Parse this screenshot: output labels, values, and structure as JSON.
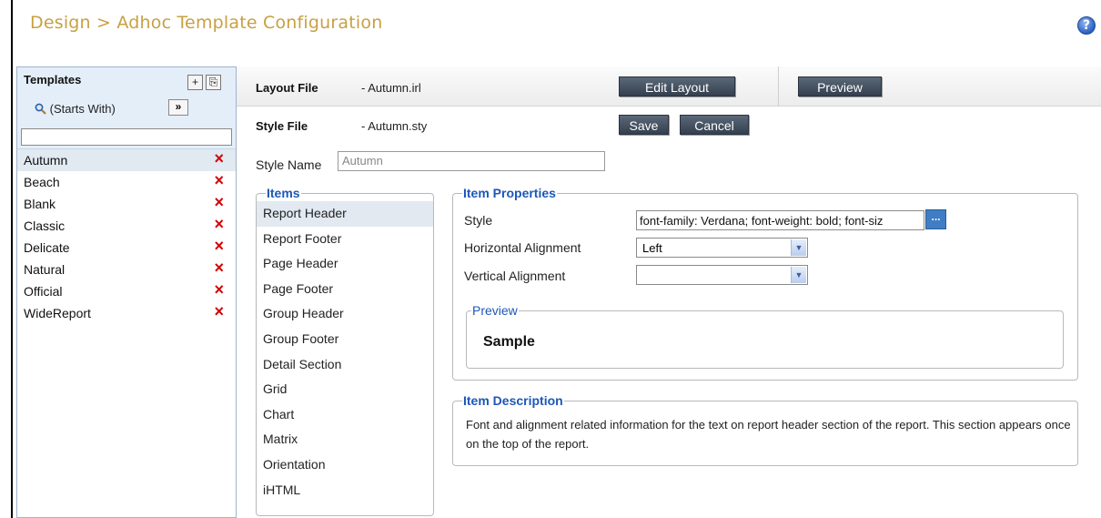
{
  "header": {
    "title": "Design > Adhoc Template Configuration",
    "help_label": "?"
  },
  "sidebar": {
    "title": "Templates",
    "add_label": "+",
    "paste_label": "⎘",
    "filter_label": "(Starts With)",
    "go_label": "»",
    "search_value": "",
    "templates": [
      {
        "name": "Autumn",
        "selected": true
      },
      {
        "name": "Beach"
      },
      {
        "name": "Blank"
      },
      {
        "name": "Classic"
      },
      {
        "name": "Delicate"
      },
      {
        "name": "Natural"
      },
      {
        "name": "Official"
      },
      {
        "name": "WideReport"
      }
    ],
    "delete_label": "×"
  },
  "layout": {
    "label": "Layout File",
    "value": "- Autumn.irl",
    "edit_button": "Edit Layout",
    "preview_button": "Preview"
  },
  "style_file": {
    "label": "Style File",
    "value": "- Autumn.sty",
    "save_button": "Save",
    "cancel_button": "Cancel"
  },
  "style_name": {
    "label": "Style Name",
    "value": "Autumn"
  },
  "items": {
    "legend": "Items",
    "list": [
      "Report Header",
      "Report Footer",
      "Page Header",
      "Page Footer",
      "Group Header",
      "Group Footer",
      "Detail Section",
      "Grid",
      "Chart",
      "Matrix",
      "Orientation",
      "iHTML"
    ],
    "selected": "Report Header"
  },
  "item_properties": {
    "legend": "Item Properties",
    "style_label": "Style",
    "style_value": "font-family: Verdana; font-weight: bold; font-siz",
    "style_button": "...",
    "h_align_label": "Horizontal Alignment",
    "h_align_value": "Left",
    "v_align_label": "Vertical Alignment",
    "v_align_value": "",
    "preview_legend": "Preview",
    "preview_sample": "Sample"
  },
  "item_description": {
    "legend": "Item Description",
    "text": "Font and alignment related information for the text on report header section of the report. This section appears once on the top of the report."
  },
  "colors": {
    "title": "#c8a043",
    "legend": "#1c57b8",
    "button_dark": "#3f4a58",
    "delete": "#d40000"
  }
}
